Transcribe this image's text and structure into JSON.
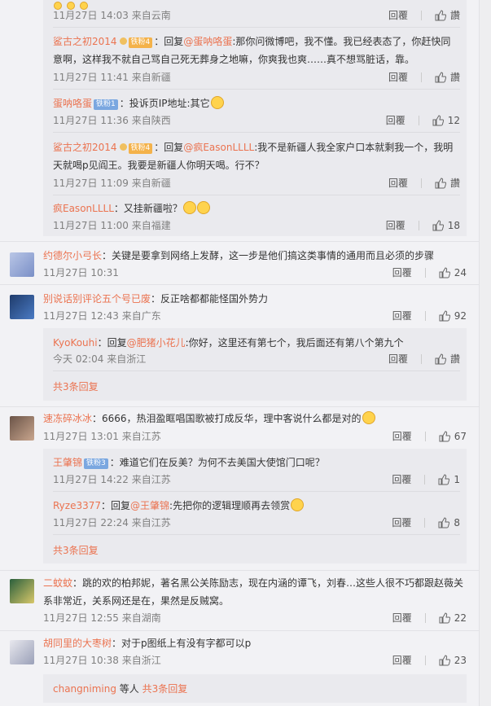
{
  "actions": {
    "reply": "回覆",
    "like": "讚"
  },
  "comments": [
    {
      "meta": "11月27日 14:03 来自云南",
      "likes": "讚"
    },
    {
      "user": "鲨古之初2014",
      "badge": "铁粉4",
      "prefix": "回复",
      "to": "@蛋呐咯蛋",
      "text": ":那你问微博吧，我不懂。我已经表态了，你赶快同意啊，这样我不就自己骂自己死无葬身之地嘛，你爽我也爽……真不想骂脏话，靠。",
      "meta": "11月27日 11:41 来自新疆",
      "likes": "讚"
    },
    {
      "user": "蛋呐咯蛋",
      "badge": "铁粉1",
      "text": "：投诉页IP地址:其它",
      "meta": "11月27日 11:36 来自陕西",
      "likes": "12"
    },
    {
      "user": "鲨古之初2014",
      "badge": "铁粉4",
      "prefix": "回复",
      "to": "@疯EasonLLLL",
      "text": ":我不是新疆人我全家户口本就剩我一个，我明天就喝p见阎王。我要是新疆人你明天喝。行不？",
      "meta": "11月27日 11:09 来自新疆",
      "likes": "讚"
    },
    {
      "user": "疯EasonLLLL",
      "text": "：又挂新疆啦？",
      "meta": "11月27日 11:00 来自福建",
      "likes": "18"
    },
    {
      "user": "约德尔小弓长",
      "text": "：关键是要拿到网络上发酵，这一步是他们搞这类事情的通用而且必须的步骤",
      "meta": "11月27日 10:31",
      "likes": "24"
    },
    {
      "user": "别说话别评论五个号已废",
      "text": "：反正啥都都能怪国外势力",
      "meta": "11月27日 12:43 来自广东",
      "likes": "92"
    },
    {
      "user": "KyoKouhi",
      "prefix": "：回复",
      "to": "@肥猪小花儿",
      "text": ":你好，这里还有第七个，我后面还有第八个第九个",
      "meta": "今天 02:04 来自浙江",
      "likes": "讚"
    },
    {
      "more": "共3条回复"
    },
    {
      "user": "速冻碎冰冰",
      "text": "：6666，热泪盈眶唱国歌被打成反华，理中客说什么都是对的",
      "meta": "11月27日 13:01 来自江苏",
      "likes": "67"
    },
    {
      "user": "王肇锦",
      "badge": "铁粉3",
      "text": "：难道它们在反美？为何不去美国大使馆门口呢？",
      "meta": "11月27日 14:22 来自江苏",
      "likes": "1"
    },
    {
      "user": "Ryze3377",
      "prefix": "：回复",
      "to": "@王肇锦",
      "text": ":先把你的逻辑理顺再去领赏",
      "meta": "11月27日 22:24 来自江苏",
      "likes": "8"
    },
    {
      "more": "共3条回复"
    },
    {
      "user": "二蚊蚊",
      "text": "：跳的欢的柏邦妮，著名黑公关陈励志，现在内涵的谭飞，刘春…这些人很不巧都跟赵薇关系非常近，关系网还是在，果然是反贼窝。",
      "meta": "11月27日 12:55 来自湖南",
      "likes": "22"
    },
    {
      "user": "胡同里的大枣树",
      "text": "：对于p图纸上有没有字都可以p",
      "meta": "11月27日 10:38 来自浙江",
      "likes": "23"
    },
    {
      "user": "changniming",
      "mid": " 等人 ",
      "more": "共3条回复"
    }
  ]
}
